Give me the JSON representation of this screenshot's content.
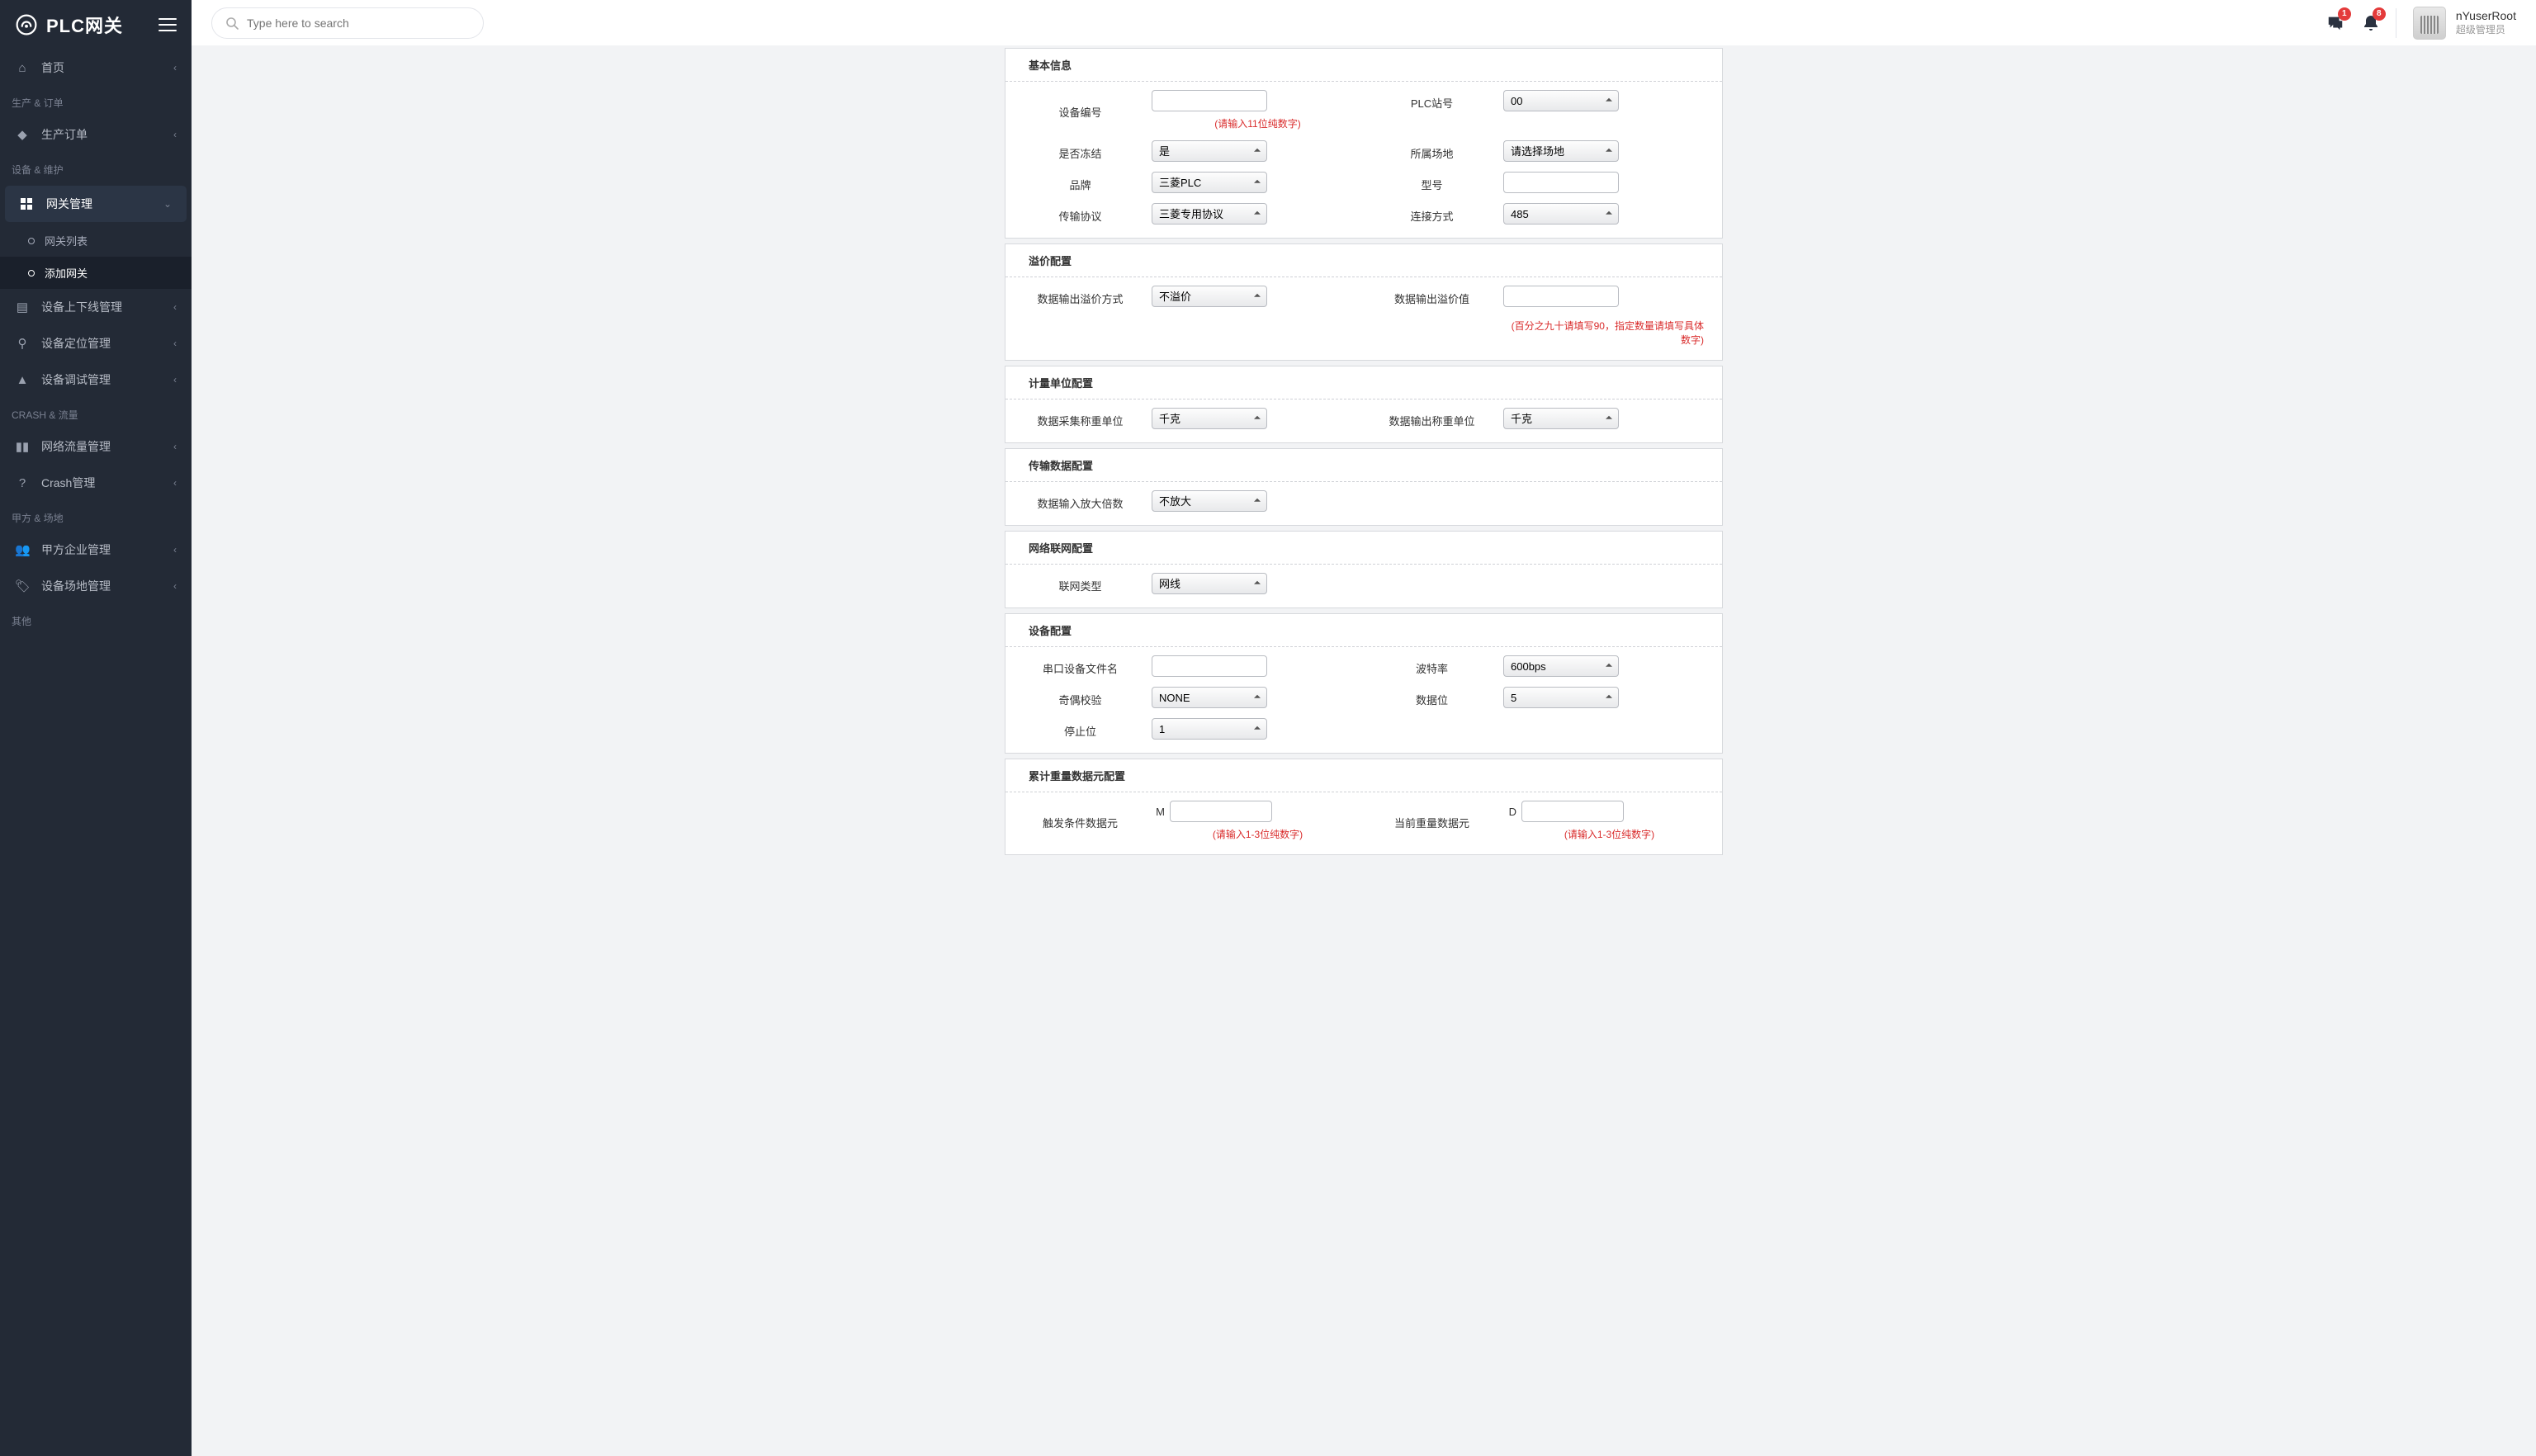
{
  "app": {
    "title": "PLC网关"
  },
  "search": {
    "placeholder": "Type here to search"
  },
  "notifications": {
    "chat_badge": "1",
    "bell_badge": "8"
  },
  "user": {
    "name": "nYuserRoot",
    "role": "超级管理员"
  },
  "sidebar": {
    "home": "首页",
    "sections": {
      "prod": "生产 & 订单",
      "dev": "设备 & 维护",
      "crash": "CRASH & 流量",
      "party": "甲方 & 场地",
      "other": "其他"
    },
    "items": {
      "prod_orders": "生产订单",
      "gateway_mgmt": "网关管理",
      "gateway_list": "网关列表",
      "gateway_add": "添加网关",
      "device_online": "设备上下线管理",
      "device_locate": "设备定位管理",
      "device_debug": "设备调试管理",
      "net_traffic": "网络流量管理",
      "crash_mgmt": "Crash管理",
      "party_org": "甲方企业管理",
      "device_site": "设备场地管理"
    }
  },
  "form": {
    "sections": {
      "basic": "基本信息",
      "premium": "溢价配置",
      "unit": "计量单位配置",
      "trans": "传输数据配置",
      "net": "网络联网配置",
      "devcfg": "设备配置",
      "accum": "累计重量数据元配置"
    },
    "labels": {
      "device_no": "设备编号",
      "plc_station": "PLC站号",
      "frozen": "是否冻结",
      "site": "所属场地",
      "brand": "品牌",
      "model": "型号",
      "protocol": "传输协议",
      "conn": "连接方式",
      "premium_mode": "数据输出溢价方式",
      "premium_value": "数据输出溢价值",
      "collect_unit": "数据采集称重单位",
      "output_unit": "数据输出称重单位",
      "input_scale": "数据输入放大倍数",
      "net_type": "联网类型",
      "serial_file": "串口设备文件名",
      "baud": "波特率",
      "parity": "奇偶校验",
      "databits": "数据位",
      "stopbits": "停止位",
      "trigger_de": "触发条件数据元",
      "current_wt_de": "当前重量数据元"
    },
    "values": {
      "plc_station": "00",
      "frozen": "是",
      "site": "请选择场地",
      "brand": "三菱PLC",
      "protocol": "三菱专用协议",
      "conn": "485",
      "premium_mode": "不溢价",
      "collect_unit": "千克",
      "output_unit": "千克",
      "input_scale": "不放大",
      "net_type": "网线",
      "baud": "600bps",
      "parity": "NONE",
      "databits": "5",
      "stopbits": "1"
    },
    "prefixes": {
      "trigger": "M",
      "current_wt": "D"
    },
    "hints": {
      "device_no": "(请输入11位纯数字)",
      "premium_value": "(百分之九十请填写90，指定数量请填写具体数字)",
      "trigger_de": "(请输入1-3位纯数字)",
      "current_wt_de": "(请输入1-3位纯数字)"
    }
  }
}
